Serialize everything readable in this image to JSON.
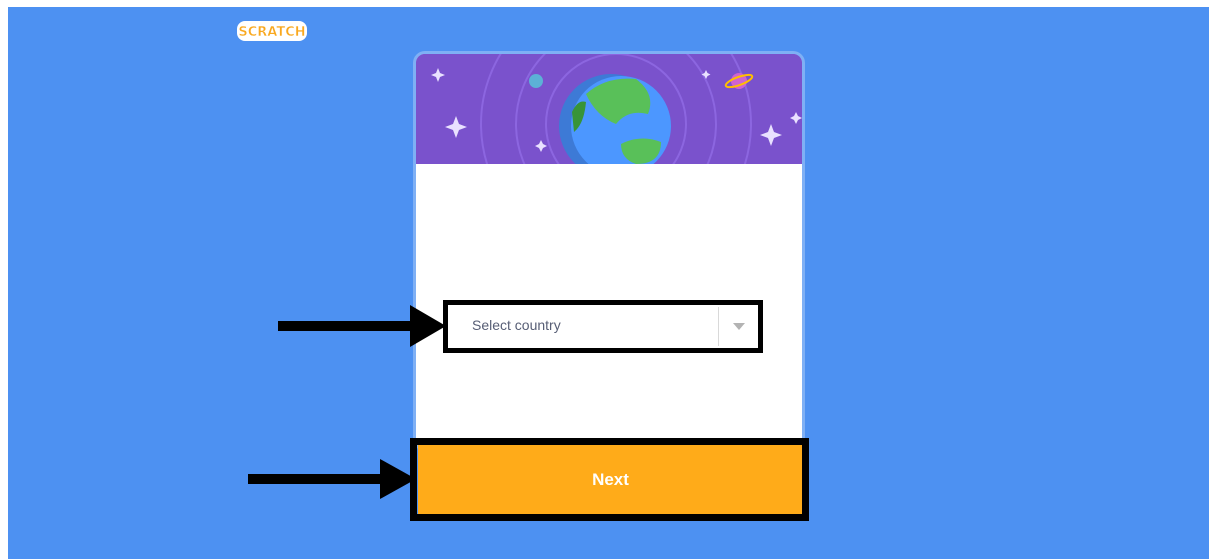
{
  "app": {
    "logo_text": "SCRATCH",
    "brand_color": "#ffab19",
    "background_color": "#4d91f2"
  },
  "card": {
    "banner_illustration": "globe-illustration",
    "country_select": {
      "placeholder": "Select country",
      "selected_value": "Select country",
      "icon": "chevron-down-icon"
    },
    "next_button": {
      "label": "Next"
    }
  },
  "annotations": {
    "highlight_color": "#000000",
    "arrow_icon": "arrow-right-icon"
  }
}
